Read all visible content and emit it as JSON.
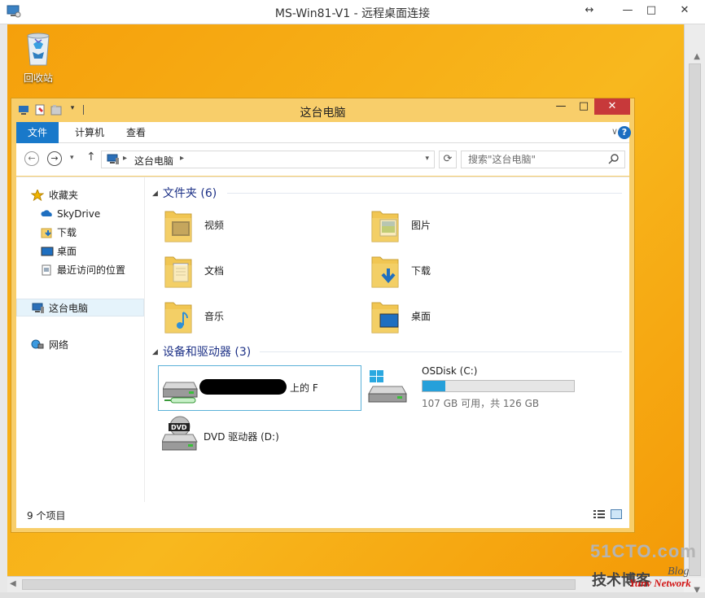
{
  "remote_window": {
    "title": "MS-Win81-V1 - 远程桌面连接",
    "controls": {
      "restore": "↔",
      "minimize": "—",
      "maximize": "□",
      "close": "✕"
    }
  },
  "desktop": {
    "icons": [
      {
        "label": "回收站",
        "icon": "recycle-bin-icon"
      }
    ]
  },
  "explorer": {
    "title": "这台电脑",
    "tabs": [
      "文件",
      "计算机",
      "查看"
    ],
    "address": {
      "location": "这台电脑"
    },
    "search": {
      "placeholder": "搜索\"这台电脑\""
    },
    "nav_pane": {
      "items": [
        {
          "label": "收藏夹",
          "icon": "star-icon"
        },
        {
          "label": "SkyDrive",
          "icon": "skydrive-icon"
        },
        {
          "label": "下载",
          "icon": "downloads-icon"
        },
        {
          "label": "桌面",
          "icon": "desktop-icon"
        },
        {
          "label": "最近访问的位置",
          "icon": "recent-places-icon"
        },
        {
          "label": "这台电脑",
          "icon": "this-pc-icon",
          "selected": true
        },
        {
          "label": "网络",
          "icon": "network-icon"
        }
      ]
    },
    "folders_group": {
      "header": "文件夹 (6)",
      "items": [
        {
          "label": "视频",
          "icon": "videos-folder-icon"
        },
        {
          "label": "图片",
          "icon": "pictures-folder-icon"
        },
        {
          "label": "文档",
          "icon": "documents-folder-icon"
        },
        {
          "label": "下载",
          "icon": "downloads-folder-icon"
        },
        {
          "label": "音乐",
          "icon": "music-folder-icon"
        },
        {
          "label": "桌面",
          "icon": "desktop-folder-icon"
        }
      ]
    },
    "devices_group": {
      "header": "设备和驱动器 (3)",
      "network_drive": {
        "label_suffix": "上的 F"
      },
      "osdisk": {
        "label": "OSDisk (C:)",
        "info": "107 GB 可用，共 126 GB",
        "used_fraction": 0.15
      },
      "dvd": {
        "label": "DVD 驱动器 (D:)"
      }
    },
    "status": {
      "item_count": "9 个项目"
    }
  },
  "watermark": {
    "site": "51CTO.com",
    "subtitle": "技术博客",
    "blog": "Blog",
    "brand": "Yunv Network"
  },
  "colors": {
    "desktop_bg": "#f8b81e",
    "window_frame": "#f8ce6a",
    "file_tab": "#1979ca",
    "close_button": "#c7393a",
    "capacity_fill": "#26a0da",
    "group_header": "#1e3287"
  }
}
